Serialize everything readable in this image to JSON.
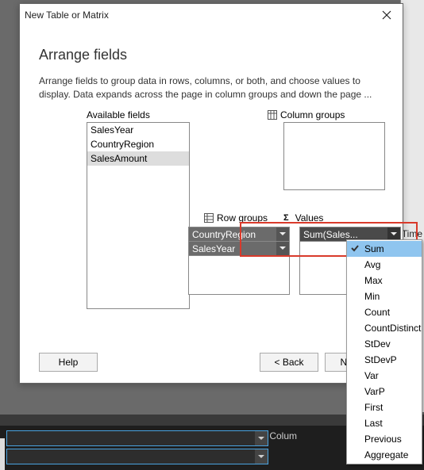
{
  "dialog": {
    "title": "New Table or Matrix",
    "heading": "Arrange fields",
    "description": "Arrange fields to group data in rows, columns, or both, and choose values to display. Data expands across the page in column groups and down the page ..."
  },
  "labels": {
    "available": "Available fields",
    "columnGroups": "Column groups",
    "rowGroups": "Row groups",
    "values": "Values"
  },
  "available": {
    "items": [
      "SalesYear",
      "CountryRegion",
      "SalesAmount"
    ],
    "selectedIndex": 2
  },
  "rowGroups": [
    "CountryRegion",
    "SalesYear"
  ],
  "columnGroups": [],
  "values": [
    {
      "label": "Sum(Sales..."
    }
  ],
  "aggregateMenu": {
    "selectedIndex": 0,
    "items": [
      "Sum",
      "Avg",
      "Max",
      "Min",
      "Count",
      "CountDistinct",
      "StDev",
      "StDevP",
      "Var",
      "VarP",
      "First",
      "Last",
      "Previous",
      "Aggregate"
    ]
  },
  "buttons": {
    "help": "Help",
    "back": "<  Back",
    "next": "Next  >"
  },
  "background": {
    "rightLabel": "nTime",
    "bottomLabel": "Colum"
  }
}
